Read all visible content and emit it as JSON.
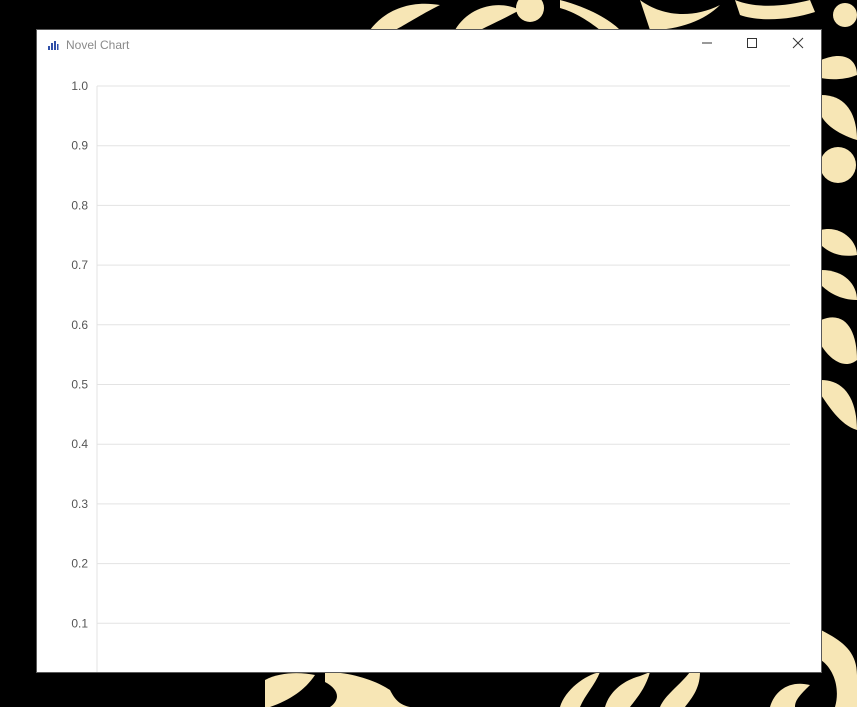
{
  "window": {
    "title": "Novel Chart",
    "app_icon": "bar-chart-icon",
    "controls": [
      "minimize-icon",
      "maximize-icon",
      "close-icon"
    ]
  },
  "wallpaper": {
    "background_color": "#000000",
    "pattern_color": "#F7E6B5"
  },
  "chart_data": {
    "type": "bar",
    "title": "",
    "xlabel": "",
    "ylabel": "",
    "categories": [],
    "values": [],
    "ylim": [
      0,
      1.0
    ],
    "yticks": [
      "0.1",
      "0.2",
      "0.3",
      "0.4",
      "0.5",
      "0.6",
      "0.7",
      "0.8",
      "0.9",
      "1.0"
    ],
    "grid": true,
    "gridline_color": "#E3E3E3",
    "legend": "none"
  }
}
